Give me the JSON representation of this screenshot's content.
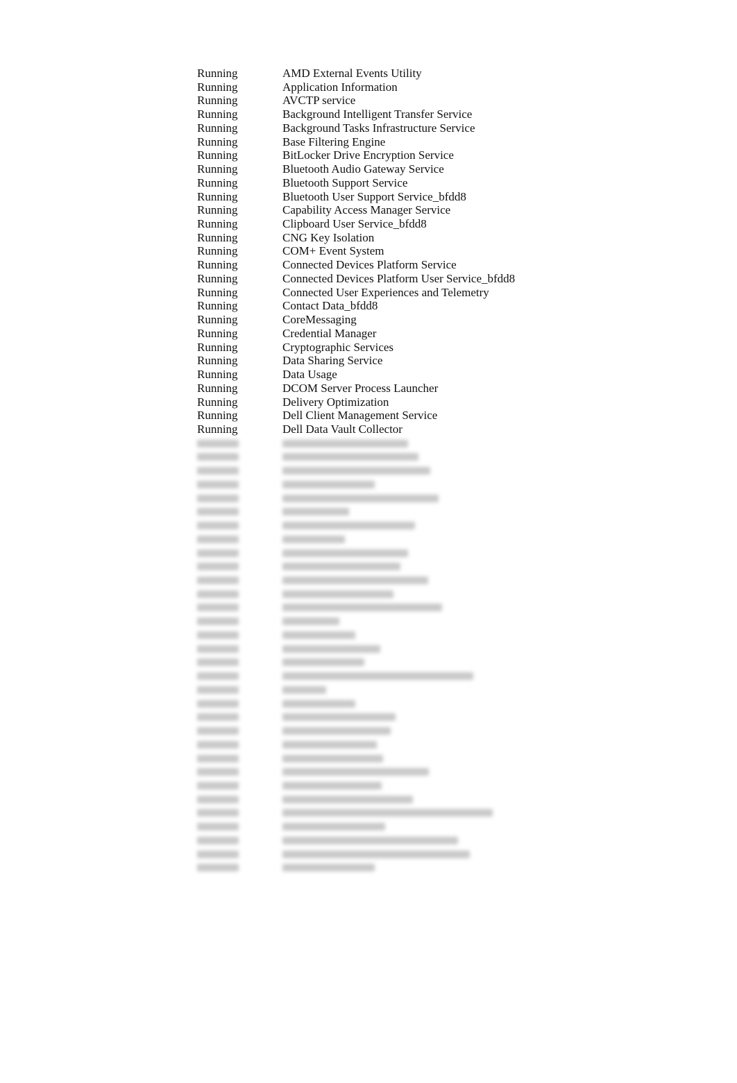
{
  "services": [
    {
      "status": "Running",
      "name": "AMD External Events Utility"
    },
    {
      "status": "Running",
      "name": "Application Information"
    },
    {
      "status": "Running",
      "name": "AVCTP service"
    },
    {
      "status": "Running",
      "name": "Background Intelligent Transfer Service"
    },
    {
      "status": "Running",
      "name": "Background Tasks Infrastructure Service"
    },
    {
      "status": "Running",
      "name": "Base Filtering Engine"
    },
    {
      "status": "Running",
      "name": "BitLocker Drive Encryption Service"
    },
    {
      "status": "Running",
      "name": "Bluetooth Audio Gateway Service"
    },
    {
      "status": "Running",
      "name": "Bluetooth Support Service"
    },
    {
      "status": "Running",
      "name": "Bluetooth User Support Service_bfdd8"
    },
    {
      "status": "Running",
      "name": "Capability Access Manager Service"
    },
    {
      "status": "Running",
      "name": "Clipboard User Service_bfdd8"
    },
    {
      "status": "Running",
      "name": "CNG Key Isolation"
    },
    {
      "status": "Running",
      "name": "COM+ Event System"
    },
    {
      "status": "Running",
      "name": "Connected Devices Platform Service"
    },
    {
      "status": "Running",
      "name": "Connected Devices Platform User Service_bfdd8"
    },
    {
      "status": "Running",
      "name": "Connected User Experiences and Telemetry"
    },
    {
      "status": "Running",
      "name": "Contact Data_bfdd8"
    },
    {
      "status": "Running",
      "name": "CoreMessaging"
    },
    {
      "status": "Running",
      "name": "Credential Manager"
    },
    {
      "status": "Running",
      "name": "Cryptographic Services"
    },
    {
      "status": "Running",
      "name": "Data Sharing Service"
    },
    {
      "status": "Running",
      "name": "Data Usage"
    },
    {
      "status": "Running",
      "name": "DCOM Server Process Launcher"
    },
    {
      "status": "Running",
      "name": "Delivery Optimization"
    },
    {
      "status": "Running",
      "name": "Dell Client Management Service"
    },
    {
      "status": "Running",
      "name": "Dell Data Vault Collector"
    }
  ]
}
